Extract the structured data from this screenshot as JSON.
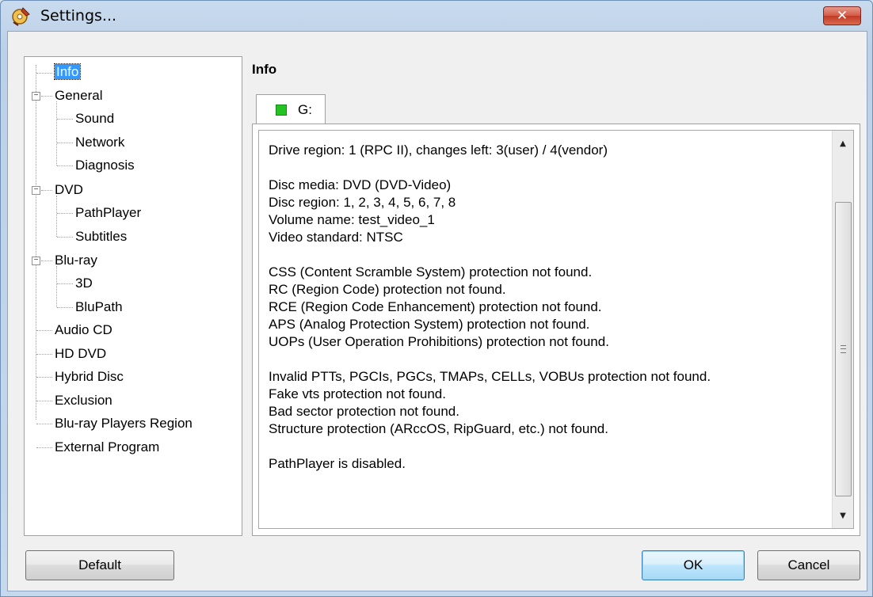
{
  "window": {
    "title": "Settings...",
    "close_label": "✕"
  },
  "tree": {
    "items": [
      {
        "label": "Info",
        "selected": true
      },
      {
        "label": "General"
      },
      {
        "label": "Sound"
      },
      {
        "label": "Network"
      },
      {
        "label": "Diagnosis"
      },
      {
        "label": "DVD"
      },
      {
        "label": "PathPlayer"
      },
      {
        "label": "Subtitles"
      },
      {
        "label": "Blu-ray"
      },
      {
        "label": "3D"
      },
      {
        "label": "BluPath"
      },
      {
        "label": "Audio CD"
      },
      {
        "label": "HD DVD"
      },
      {
        "label": "Hybrid Disc"
      },
      {
        "label": "Exclusion"
      },
      {
        "label": "Blu-ray Players Region"
      },
      {
        "label": "External Program"
      }
    ]
  },
  "panel": {
    "header": "Info",
    "tab_label": "G:",
    "tab_indicator_color": "#22c322",
    "info_lines": [
      "Drive region: 1 (RPC II), changes left: 3(user) / 4(vendor)",
      "",
      "Disc media: DVD (DVD-Video)",
      "Disc region: 1, 2, 3, 4, 5, 6, 7, 8",
      "Volume name: test_video_1",
      "Video standard: NTSC",
      "",
      "CSS (Content Scramble System) protection not found.",
      "RC (Region Code) protection not found.",
      "RCE (Region Code Enhancement) protection not found.",
      "APS (Analog Protection System) protection not found.",
      "UOPs (User Operation Prohibitions) protection not found.",
      "",
      "Invalid PTTs, PGCIs, PGCs, TMAPs, CELLs, VOBUs protection not found.",
      "Fake vts protection not found.",
      "Bad sector protection not found.",
      "Structure protection (ARccOS, RipGuard, etc.) not found.",
      "",
      "PathPlayer is disabled."
    ]
  },
  "buttons": {
    "default_label": "Default",
    "ok_label": "OK",
    "cancel_label": "Cancel"
  }
}
